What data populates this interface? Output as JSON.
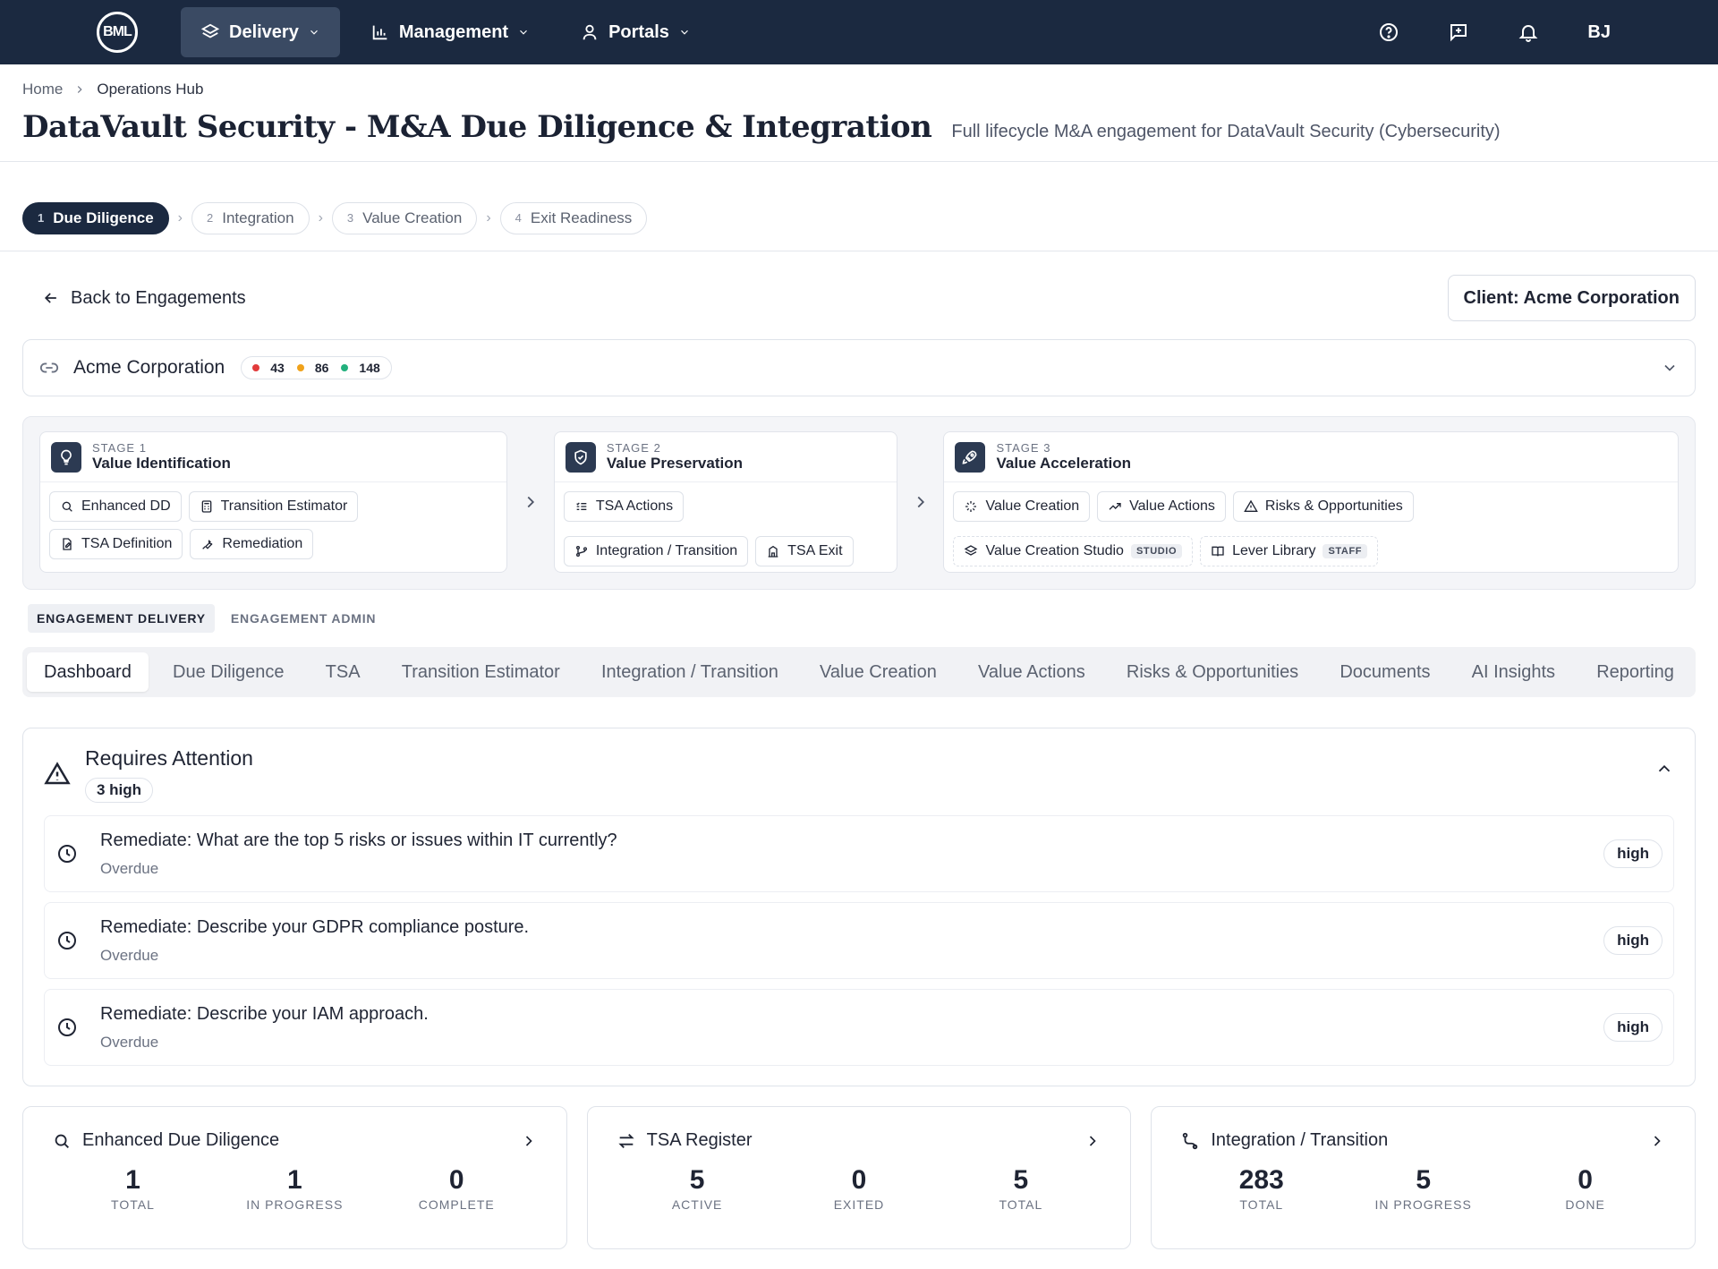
{
  "nav": {
    "logo": "BML",
    "items": [
      {
        "label": "Delivery",
        "icon": "layers-icon",
        "active": true
      },
      {
        "label": "Management",
        "icon": "bar-chart-icon",
        "active": false
      },
      {
        "label": "Portals",
        "icon": "user-icon",
        "active": false
      }
    ],
    "right_icons": [
      "help-icon",
      "feedback-icon",
      "bell-icon"
    ],
    "avatar": "BJ"
  },
  "breadcrumb": {
    "home": "Home",
    "current": "Operations Hub"
  },
  "page": {
    "title": "DataVault Security - M&A Due Diligence & Integration",
    "subtitle": "Full lifecycle M&A engagement for DataVault Security (Cybersecurity)"
  },
  "stepper": [
    {
      "num": "1",
      "label": "Due Diligence",
      "active": true
    },
    {
      "num": "2",
      "label": "Integration",
      "active": false
    },
    {
      "num": "3",
      "label": "Value Creation",
      "active": false
    },
    {
      "num": "4",
      "label": "Exit Readiness",
      "active": false
    }
  ],
  "back_label": "Back to Engagements",
  "client_label": "Client: Acme Corporation",
  "acme": {
    "name": "Acme Corporation",
    "counts": [
      {
        "value": "43",
        "color": "#e23b3b"
      },
      {
        "value": "86",
        "color": "#f0a21b"
      },
      {
        "value": "148",
        "color": "#22b07d"
      }
    ]
  },
  "stages": [
    {
      "num": "STAGE 1",
      "name": "Value Identification",
      "icon": "lightbulb-icon",
      "links": [
        {
          "label": "Enhanced DD",
          "icon": "search-icon"
        },
        {
          "label": "Transition Estimator",
          "icon": "calculator-icon"
        },
        {
          "label": "TSA Definition",
          "icon": "file-edit-icon"
        },
        {
          "label": "Remediation",
          "icon": "wrench-icon"
        }
      ]
    },
    {
      "num": "STAGE 2",
      "name": "Value Preservation",
      "icon": "shield-icon",
      "links": [
        {
          "label": "TSA Actions",
          "icon": "list-check-icon"
        },
        {
          "label": "Integration / Transition",
          "icon": "git-branch-icon"
        },
        {
          "label": "TSA Exit",
          "icon": "building-icon"
        }
      ]
    },
    {
      "num": "STAGE 3",
      "name": "Value Acceleration",
      "icon": "rocket-icon",
      "links": [
        {
          "label": "Value Creation",
          "icon": "sparkle-icon"
        },
        {
          "label": "Value Actions",
          "icon": "trend-up-icon"
        },
        {
          "label": "Risks & Opportunities",
          "icon": "warning-icon"
        },
        {
          "label": "Value Creation Studio",
          "icon": "layers-icon",
          "tag": "STUDIO"
        },
        {
          "label": "Lever Library",
          "icon": "book-icon",
          "tag": "STAFF"
        }
      ]
    }
  ],
  "segment": [
    "ENGAGEMENT DELIVERY",
    "ENGAGEMENT ADMIN"
  ],
  "tabs": [
    "Dashboard",
    "Due Diligence",
    "TSA",
    "Transition Estimator",
    "Integration / Transition",
    "Value Creation",
    "Value Actions",
    "Risks & Opportunities",
    "Documents",
    "AI Insights",
    "Reporting"
  ],
  "attention": {
    "title": "Requires Attention",
    "badge": "3 high",
    "items": [
      {
        "text": "Remediate: What are the top 5 risks or issues within IT currently?",
        "status": "Overdue",
        "priority": "high"
      },
      {
        "text": "Remediate: Describe your GDPR compliance posture.",
        "status": "Overdue",
        "priority": "high"
      },
      {
        "text": "Remediate: Describe your IAM approach.",
        "status": "Overdue",
        "priority": "high"
      }
    ]
  },
  "cards": [
    {
      "title": "Enhanced Due Diligence",
      "icon": "search-icon",
      "stats": [
        {
          "value": "1",
          "label": "TOTAL"
        },
        {
          "value": "1",
          "label": "IN PROGRESS"
        },
        {
          "value": "0",
          "label": "COMPLETE"
        }
      ]
    },
    {
      "title": "TSA Register",
      "icon": "swap-icon",
      "stats": [
        {
          "value": "5",
          "label": "ACTIVE"
        },
        {
          "value": "0",
          "label": "EXITED"
        },
        {
          "value": "5",
          "label": "TOTAL"
        }
      ]
    },
    {
      "title": "Integration / Transition",
      "icon": "route-icon",
      "stats": [
        {
          "value": "283",
          "label": "TOTAL"
        },
        {
          "value": "5",
          "label": "IN PROGRESS"
        },
        {
          "value": "0",
          "label": "DONE"
        }
      ]
    }
  ]
}
